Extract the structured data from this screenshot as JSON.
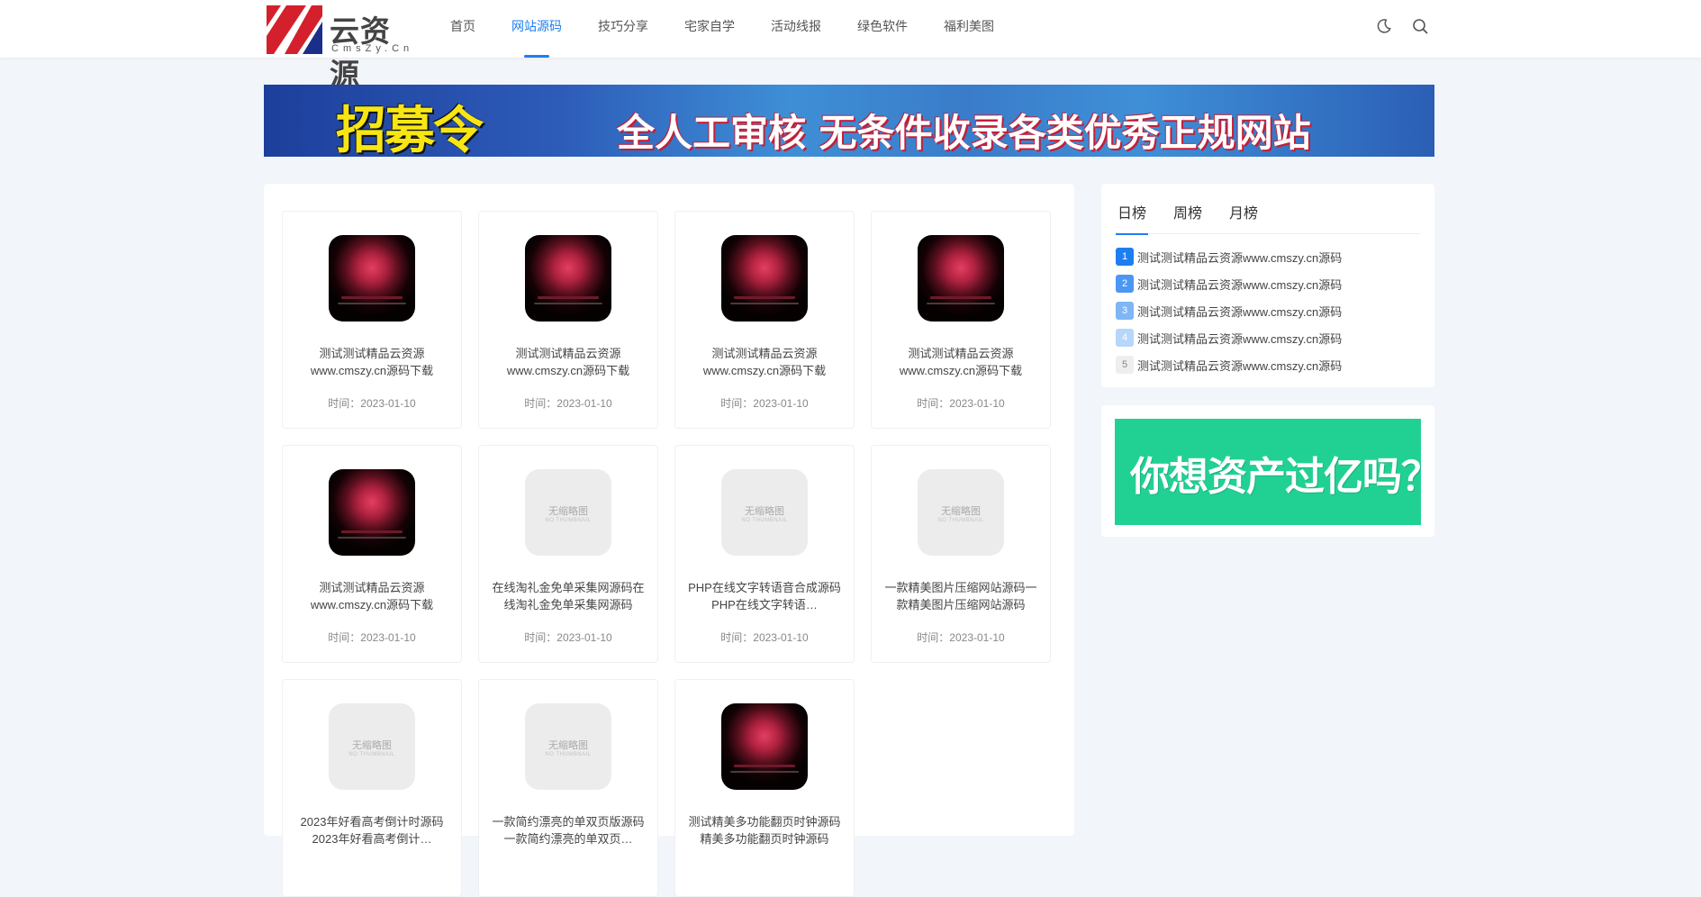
{
  "header": {
    "logo_text": "云资源",
    "logo_sub": "CmsZy.Cn",
    "nav": [
      "首页",
      "网站源码",
      "技巧分享",
      "宅家自学",
      "活动线报",
      "绿色软件",
      "福利美图"
    ],
    "active_nav": "网站源码",
    "icons": [
      "moon-icon",
      "search-icon"
    ]
  },
  "banner": {
    "headline": "招募令",
    "text": "全人工审核 无条件收录各类优秀正规网站"
  },
  "posts": [
    {
      "title": "测试测试精品云资源www.cmszy.cn源码下载",
      "time": "时间：2023-01-10",
      "thumbnail": "dark"
    },
    {
      "title": "测试测试精品云资源www.cmszy.cn源码下载",
      "time": "时间：2023-01-10",
      "thumbnail": "dark"
    },
    {
      "title": "测试测试精品云资源www.cmszy.cn源码下载",
      "time": "时间：2023-01-10",
      "thumbnail": "dark"
    },
    {
      "title": "测试测试精品云资源www.cmszy.cn源码下载",
      "time": "时间：2023-01-10",
      "thumbnail": "dark"
    },
    {
      "title": "测试测试精品云资源www.cmszy.cn源码下载",
      "time": "时间：2023-01-10",
      "thumbnail": "dark"
    },
    {
      "title": "在线淘礼金免单采集网源码在线淘礼金免单采集网源码",
      "time": "时间：2023-01-10",
      "thumbnail": "none"
    },
    {
      "title": "PHP在线文字转语音合成源码PHP在线文字转语…",
      "time": "时间：2023-01-10",
      "thumbnail": "none"
    },
    {
      "title": "一款精美图片压缩网站源码一款精美图片压缩网站源码",
      "time": "时间：2023-01-10",
      "thumbnail": "none"
    },
    {
      "title": "2023年好看高考倒计时源码2023年好看高考倒计…",
      "time": "",
      "thumbnail": "none"
    },
    {
      "title": "一款简约漂亮的单双页版源码一款简约漂亮的单双页…",
      "time": "",
      "thumbnail": "none"
    },
    {
      "title": "测试精美多功能翻页时钟源码精美多功能翻页时钟源码",
      "time": "",
      "thumbnail": "dark"
    }
  ],
  "no_thumbnail": {
    "label": "无缩略图",
    "sub": "NO THUMBNAIL"
  },
  "ranking": {
    "tabs": [
      "日榜",
      "周榜",
      "月榜"
    ],
    "active_tab": "日榜",
    "items": [
      {
        "rank": "1",
        "title": "测试测试精品云资源www.cmszy.cn源码",
        "color": "#1e7ef0"
      },
      {
        "rank": "2",
        "title": "测试测试精品云资源www.cmszy.cn源码",
        "color": "#4b97f3"
      },
      {
        "rank": "3",
        "title": "测试测试精品云资源www.cmszy.cn源码",
        "color": "#7eb6f6"
      },
      {
        "rank": "4",
        "title": "测试测试精品云资源www.cmszy.cn源码",
        "color": "#b6d6fa"
      },
      {
        "rank": "5",
        "title": "测试测试精品云资源www.cmszy.cn源码",
        "color": "#eeeeee"
      }
    ]
  },
  "ad": {
    "text": "你想资产过亿吗？",
    "color": "#21d194"
  },
  "colors": {
    "accent": "#1e7ef0",
    "background": "#f2f5f9"
  }
}
